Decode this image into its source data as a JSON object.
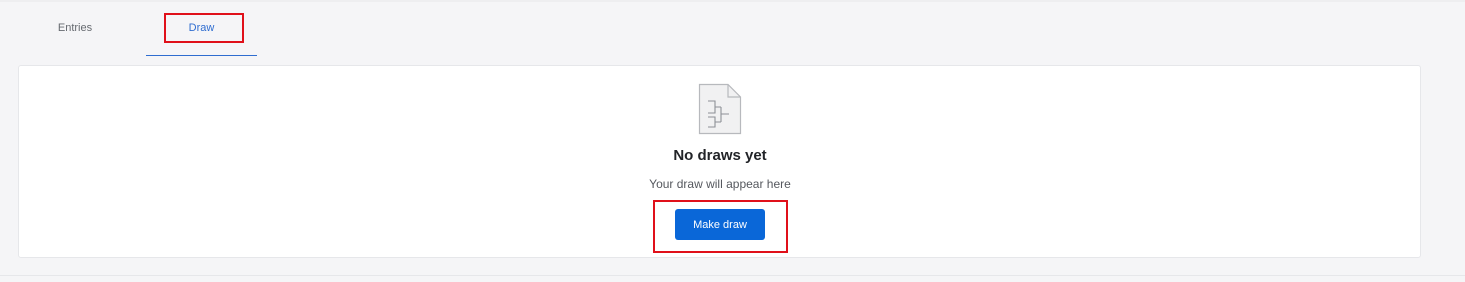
{
  "tabs": [
    {
      "label": "Entries",
      "active": false
    },
    {
      "label": "Draw",
      "active": true
    }
  ],
  "empty_state": {
    "icon": "bracket-document-icon",
    "title": "No draws yet",
    "subtitle": "Your draw will appear here",
    "button_label": "Make draw"
  },
  "colors": {
    "accent": "#0a67d8",
    "highlight": "#e0101a",
    "active_tab": "#2f6dd0"
  }
}
